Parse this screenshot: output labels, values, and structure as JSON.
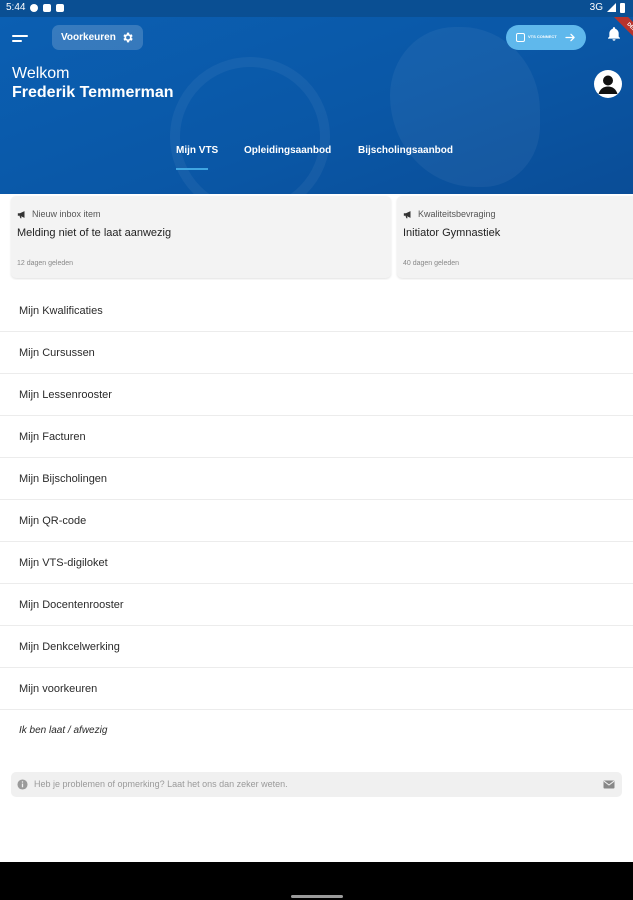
{
  "status_bar": {
    "time": "5:44",
    "network": "3G"
  },
  "header": {
    "preferences_label": "Voorkeuren",
    "connect_label": "VTS CONNECT",
    "debug_label": "DEBUG",
    "greeting": "Welkom",
    "user_name": "Frederik Temmerman"
  },
  "tabs": [
    {
      "label": "Mijn VTS",
      "active": true
    },
    {
      "label": "Opleidingsaanbod",
      "active": false
    },
    {
      "label": "Bijscholingsaanbod",
      "active": false
    }
  ],
  "inbox_cards": [
    {
      "tag": "Nieuw inbox item",
      "title": "Melding niet of te laat aanwezig",
      "date": "12 dagen geleden"
    },
    {
      "tag": "Kwaliteitsbevraging",
      "title": "Initiator Gymnastiek",
      "date": "40 dagen geleden"
    }
  ],
  "menu_items": [
    "Mijn Kwalificaties",
    "Mijn Cursussen",
    "Mijn Lessenrooster",
    "Mijn Facturen",
    "Mijn Bijscholingen",
    "Mijn QR-code",
    "Mijn VTS-digiloket",
    "Mijn Docentenrooster",
    "Mijn Denkcelwerking",
    "Mijn voorkeuren"
  ],
  "absence_link": "Ik ben laat / afwezig",
  "feedback": {
    "placeholder": "Heb je problemen of opmerking? Laat het ons dan zeker weten."
  },
  "colors": {
    "primary": "#0a57a6",
    "accent": "#5fb8ec",
    "tab_indicator": "#3fa6e2"
  }
}
